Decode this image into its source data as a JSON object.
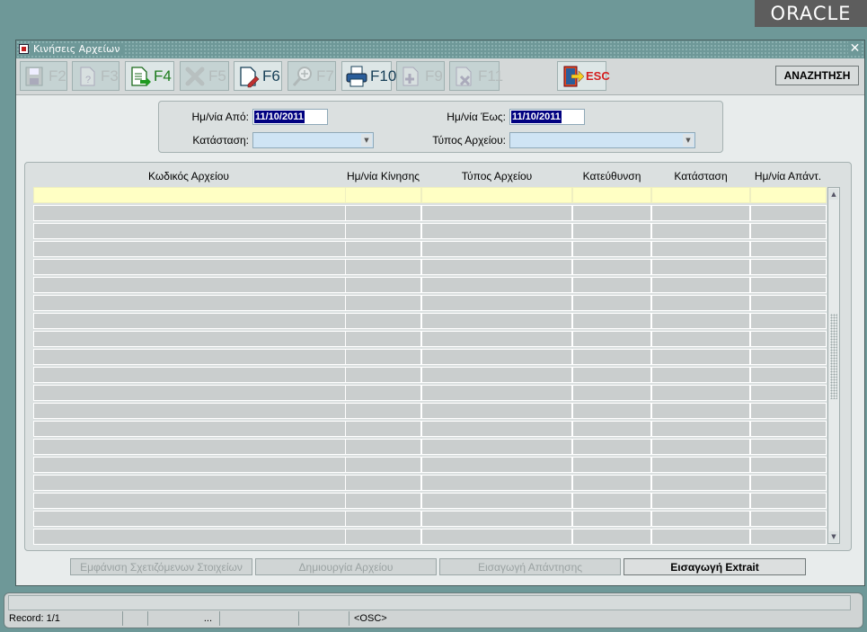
{
  "brand": {
    "logo_text": "ORACLE"
  },
  "window": {
    "title": "Κινήσεις Αρχείων",
    "close_label": "✕"
  },
  "toolbar": {
    "buttons": [
      {
        "key": "F2",
        "icon": "save-icon",
        "enabled": false
      },
      {
        "key": "F3",
        "icon": "query-icon",
        "enabled": false
      },
      {
        "key": "F4",
        "icon": "export-doc-icon",
        "enabled": true
      },
      {
        "key": "F5",
        "icon": "delete-x-icon",
        "enabled": false
      },
      {
        "key": "F6",
        "icon": "edit-doc-icon",
        "enabled": true
      },
      {
        "key": "F7",
        "icon": "zoom-icon",
        "enabled": false
      },
      {
        "key": "F10",
        "icon": "print-icon",
        "enabled": true
      },
      {
        "key": "F9",
        "icon": "add-record-icon",
        "enabled": false
      },
      {
        "key": "F11",
        "icon": "remove-record-icon",
        "enabled": false
      }
    ],
    "exit_label": "ESC",
    "search_label": "ΑΝΑΖΗΤΗΣΗ"
  },
  "criteria": {
    "date_from_label": "Ημ/νία Από:",
    "date_from_value": "11/10/2011",
    "date_to_label": "Ημ/νία Έως:",
    "date_to_value": "11/10/2011",
    "status_label": "Κατάσταση:",
    "status_value": "",
    "file_type_label": "Τύπος Αρχείου:",
    "file_type_value": ""
  },
  "table": {
    "columns": [
      "Κωδικός Αρχείου",
      "Ημ/νία Κίνησης",
      "Τύπος Αρχείου",
      "Κατεύθυνση",
      "Κατάσταση",
      "Ημ/νία Απάντ."
    ],
    "row_count": 20,
    "selected_row": 1
  },
  "actions": {
    "related": "Εμφάνιση Σχετιζόμενων Στοιχείων",
    "create_file": "Δημιουργία Αρχείου",
    "import_reply": "Εισαγωγή Απάντησης",
    "import_extrait": "Εισαγωγή Extrait"
  },
  "status": {
    "message": "",
    "record": "Record: 1/1",
    "ellipsis": "...",
    "osc": "<OSC>"
  },
  "colors": {
    "desktop": "#6e9898",
    "current_row": "#ffffc4",
    "lov_field": "#cfe4f4",
    "selection": "#000080"
  }
}
